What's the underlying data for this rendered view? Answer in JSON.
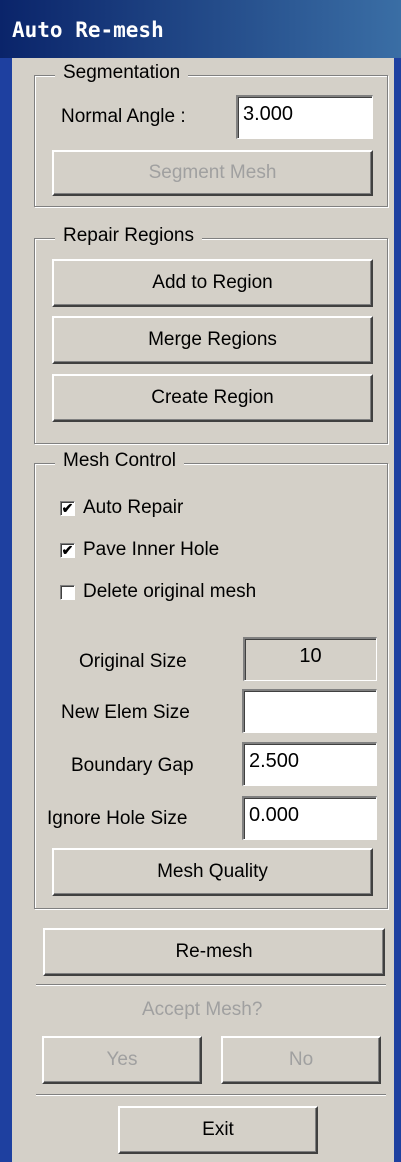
{
  "window": {
    "title": "Auto Re-mesh"
  },
  "segmentation": {
    "legend": "Segmentation",
    "normal_angle_label": "Normal Angle :",
    "normal_angle_value": "3.000",
    "segment_mesh_label": "Segment Mesh"
  },
  "repair_regions": {
    "legend": "Repair Regions",
    "add_to_region_label": "Add  to  Region",
    "merge_regions_label": "Merge   Regions",
    "create_region_label": "Create  Region"
  },
  "mesh_control": {
    "legend": "Mesh Control",
    "auto_repair": {
      "label": "Auto Repair",
      "checked": true
    },
    "pave_inner_hole": {
      "label": "Pave Inner Hole",
      "checked": true
    },
    "delete_original_mesh": {
      "label": "Delete original mesh",
      "checked": false
    },
    "original_size_label": "Original Size",
    "original_size_value": "10",
    "new_elem_size_label": "New Elem Size",
    "new_elem_size_value": "",
    "boundary_gap_label": "Boundary Gap",
    "boundary_gap_value": "2.500",
    "ignore_hole_size_label": "Ignore Hole Size",
    "ignore_hole_size_value": "0.000",
    "mesh_quality_label": "Mesh Quality"
  },
  "remesh_label": "Re-mesh",
  "accept": {
    "question": "Accept Mesh?",
    "yes_label": "Yes",
    "no_label": "No"
  },
  "exit_label": "Exit"
}
